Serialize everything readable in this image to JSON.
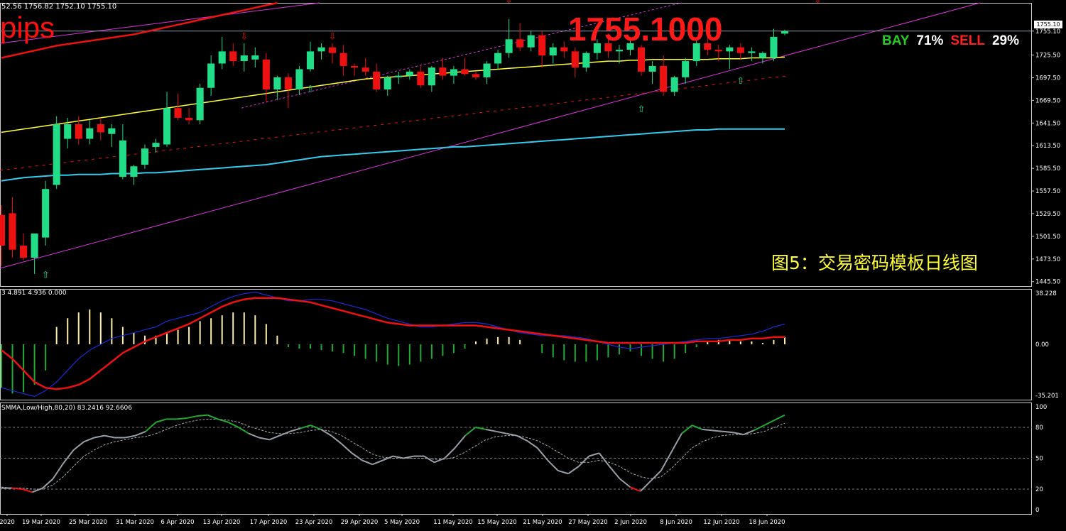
{
  "header": {
    "ohlc": "52.56 1756.82 1752.10 1755.10",
    "pips_label": "pips",
    "big_price": "1755.1000",
    "bay_label": "BAY",
    "bay_value": "71%",
    "sell_label": "SELL",
    "sell_value": "29%",
    "caption": "图5：交易密码模板日线图",
    "current_price_tag": "1755.10"
  },
  "panels": {
    "macd_header": "3 4.891 4.936 0.000",
    "stoch_header": "SMMA,Low/High,80,20) 83.2416 92.6606"
  },
  "colors": {
    "bull": "#22dd88",
    "bear": "#ee1111",
    "ma_yellow": "#ffff33",
    "ma_cyan": "#33ccee",
    "ma_red": "#ee1111",
    "channel": "#dd33dd",
    "macd_pos": "#ffeeaa",
    "macd_neg": "#22aa33",
    "macd_line": "#1a2bdd",
    "signal_line": "#ee1111",
    "stoch_main": "#9aa0aa",
    "stoch_up": "#22aa33",
    "stoch_down": "#ee1111"
  },
  "chart_data": [
    {
      "type": "candlestick",
      "title": "",
      "ylim": [
        1440,
        1790
      ],
      "y_ticks": [
        "1755.10",
        "1725.50",
        "1697.50",
        "1669.50",
        "1641.50",
        "1613.50",
        "1585.50",
        "1557.50",
        "1529.50",
        "1501.50",
        "1473.50",
        "1445.50"
      ],
      "x_ticks": [
        "2020",
        "19 Mar 2020",
        "25 Mar 2020",
        "31 Mar 2020",
        "6 Apr 2020",
        "13 Apr 2020",
        "17 Apr 2020",
        "23 Apr 2020",
        "29 Apr 2020",
        "5 May 2020",
        "11 May 2020",
        "15 May 2020",
        "21 May 2020",
        "27 May 2020",
        "2 Jun 2020",
        "8 Jun 2020",
        "12 Jun 2020",
        "18 Jun 2020"
      ],
      "candles": [
        {
          "o": 1528,
          "h": 1540,
          "l": 1465,
          "c": 1490
        },
        {
          "o": 1530,
          "h": 1550,
          "l": 1475,
          "c": 1485
        },
        {
          "o": 1490,
          "h": 1505,
          "l": 1472,
          "c": 1475
        },
        {
          "o": 1475,
          "h": 1505,
          "l": 1455,
          "c": 1505
        },
        {
          "o": 1500,
          "h": 1570,
          "l": 1490,
          "c": 1560
        },
        {
          "o": 1565,
          "h": 1650,
          "l": 1560,
          "c": 1640
        },
        {
          "o": 1622,
          "h": 1648,
          "l": 1610,
          "c": 1640
        },
        {
          "o": 1640,
          "h": 1650,
          "l": 1615,
          "c": 1622
        },
        {
          "o": 1622,
          "h": 1645,
          "l": 1615,
          "c": 1635
        },
        {
          "o": 1640,
          "h": 1648,
          "l": 1620,
          "c": 1630
        },
        {
          "o": 1628,
          "h": 1640,
          "l": 1612,
          "c": 1635
        },
        {
          "o": 1575,
          "h": 1640,
          "l": 1572,
          "c": 1620
        },
        {
          "o": 1575,
          "h": 1590,
          "l": 1565,
          "c": 1588
        },
        {
          "o": 1590,
          "h": 1615,
          "l": 1585,
          "c": 1610
        },
        {
          "o": 1612,
          "h": 1622,
          "l": 1605,
          "c": 1617
        },
        {
          "o": 1615,
          "h": 1680,
          "l": 1612,
          "c": 1660
        },
        {
          "o": 1660,
          "h": 1678,
          "l": 1645,
          "c": 1648
        },
        {
          "o": 1648,
          "h": 1660,
          "l": 1640,
          "c": 1645
        },
        {
          "o": 1645,
          "h": 1690,
          "l": 1640,
          "c": 1685
        },
        {
          "o": 1685,
          "h": 1725,
          "l": 1675,
          "c": 1715
        },
        {
          "o": 1715,
          "h": 1748,
          "l": 1708,
          "c": 1730
        },
        {
          "o": 1730,
          "h": 1740,
          "l": 1712,
          "c": 1718
        },
        {
          "o": 1718,
          "h": 1740,
          "l": 1705,
          "c": 1725
        },
        {
          "o": 1720,
          "h": 1735,
          "l": 1710,
          "c": 1725
        },
        {
          "o": 1720,
          "h": 1728,
          "l": 1668,
          "c": 1683
        },
        {
          "o": 1683,
          "h": 1700,
          "l": 1670,
          "c": 1698
        },
        {
          "o": 1698,
          "h": 1703,
          "l": 1660,
          "c": 1683
        },
        {
          "o": 1683,
          "h": 1712,
          "l": 1676,
          "c": 1708
        },
        {
          "o": 1708,
          "h": 1742,
          "l": 1705,
          "c": 1730
        },
        {
          "o": 1730,
          "h": 1740,
          "l": 1720,
          "c": 1735
        },
        {
          "o": 1735,
          "h": 1740,
          "l": 1715,
          "c": 1728
        },
        {
          "o": 1728,
          "h": 1738,
          "l": 1700,
          "c": 1712
        },
        {
          "o": 1712,
          "h": 1715,
          "l": 1700,
          "c": 1710
        },
        {
          "o": 1710,
          "h": 1722,
          "l": 1700,
          "c": 1705
        },
        {
          "o": 1705,
          "h": 1715,
          "l": 1680,
          "c": 1683
        },
        {
          "o": 1683,
          "h": 1700,
          "l": 1675,
          "c": 1698
        },
        {
          "o": 1698,
          "h": 1705,
          "l": 1690,
          "c": 1700
        },
        {
          "o": 1700,
          "h": 1708,
          "l": 1695,
          "c": 1705
        },
        {
          "o": 1705,
          "h": 1712,
          "l": 1685,
          "c": 1688
        },
        {
          "o": 1688,
          "h": 1712,
          "l": 1680,
          "c": 1710
        },
        {
          "o": 1710,
          "h": 1722,
          "l": 1695,
          "c": 1700
        },
        {
          "o": 1700,
          "h": 1712,
          "l": 1690,
          "c": 1708
        },
        {
          "o": 1708,
          "h": 1722,
          "l": 1700,
          "c": 1702
        },
        {
          "o": 1702,
          "h": 1705,
          "l": 1695,
          "c": 1698
        },
        {
          "o": 1698,
          "h": 1718,
          "l": 1690,
          "c": 1715
        },
        {
          "o": 1715,
          "h": 1732,
          "l": 1708,
          "c": 1728
        },
        {
          "o": 1728,
          "h": 1770,
          "l": 1722,
          "c": 1745
        },
        {
          "o": 1745,
          "h": 1765,
          "l": 1730,
          "c": 1735
        },
        {
          "o": 1735,
          "h": 1755,
          "l": 1730,
          "c": 1750
        },
        {
          "o": 1750,
          "h": 1755,
          "l": 1710,
          "c": 1725
        },
        {
          "o": 1725,
          "h": 1740,
          "l": 1715,
          "c": 1735
        },
        {
          "o": 1735,
          "h": 1742,
          "l": 1722,
          "c": 1730
        },
        {
          "o": 1730,
          "h": 1735,
          "l": 1698,
          "c": 1710
        },
        {
          "o": 1710,
          "h": 1730,
          "l": 1705,
          "c": 1728
        },
        {
          "o": 1728,
          "h": 1745,
          "l": 1720,
          "c": 1740
        },
        {
          "o": 1740,
          "h": 1752,
          "l": 1722,
          "c": 1730
        },
        {
          "o": 1730,
          "h": 1738,
          "l": 1715,
          "c": 1732
        },
        {
          "o": 1732,
          "h": 1745,
          "l": 1725,
          "c": 1740
        },
        {
          "o": 1735,
          "h": 1738,
          "l": 1700,
          "c": 1705
        },
        {
          "o": 1705,
          "h": 1718,
          "l": 1690,
          "c": 1712
        },
        {
          "o": 1712,
          "h": 1725,
          "l": 1675,
          "c": 1680
        },
        {
          "o": 1680,
          "h": 1700,
          "l": 1675,
          "c": 1698
        },
        {
          "o": 1698,
          "h": 1722,
          "l": 1690,
          "c": 1718
        },
        {
          "o": 1718,
          "h": 1745,
          "l": 1712,
          "c": 1740
        },
        {
          "o": 1740,
          "h": 1750,
          "l": 1725,
          "c": 1732
        },
        {
          "o": 1732,
          "h": 1738,
          "l": 1718,
          "c": 1730
        },
        {
          "o": 1730,
          "h": 1738,
          "l": 1708,
          "c": 1735
        },
        {
          "o": 1735,
          "h": 1740,
          "l": 1720,
          "c": 1728
        },
        {
          "o": 1728,
          "h": 1735,
          "l": 1718,
          "c": 1730
        },
        {
          "o": 1722,
          "h": 1730,
          "l": 1715,
          "c": 1728
        },
        {
          "o": 1722,
          "h": 1758,
          "l": 1718,
          "c": 1748
        },
        {
          "o": 1752,
          "h": 1757,
          "l": 1750,
          "c": 1755
        }
      ],
      "ma_yellow": [
        1630,
        1632,
        1634,
        1636,
        1638,
        1640,
        1642,
        1644,
        1646,
        1648,
        1650,
        1652,
        1654,
        1656,
        1658,
        1660,
        1662,
        1664,
        1666,
        1668,
        1670,
        1672,
        1674,
        1676,
        1678,
        1680,
        1682,
        1684,
        1686,
        1688,
        1690,
        1692,
        1694,
        1696,
        1697,
        1698,
        1699,
        1700,
        1701,
        1702,
        1703,
        1704,
        1705,
        1706,
        1707,
        1708,
        1709,
        1710,
        1711,
        1712,
        1713,
        1714,
        1715,
        1716,
        1717,
        1718,
        1718,
        1719,
        1719,
        1720,
        1720,
        1720,
        1720,
        1720,
        1720,
        1721,
        1721,
        1721,
        1722,
        1722,
        1722,
        1723
      ],
      "ma_cyan": [
        1570,
        1572,
        1574,
        1575,
        1576,
        1577,
        1577,
        1578,
        1578,
        1578,
        1579,
        1579,
        1579,
        1580,
        1580,
        1581,
        1582,
        1583,
        1584,
        1585,
        1586,
        1587,
        1588,
        1589,
        1590,
        1592,
        1594,
        1596,
        1598,
        1600,
        1601,
        1602,
        1603,
        1604,
        1605,
        1606,
        1607,
        1608,
        1609,
        1610,
        1611,
        1612,
        1612,
        1613,
        1614,
        1615,
        1616,
        1617,
        1618,
        1619,
        1620,
        1621,
        1622,
        1623,
        1624,
        1625,
        1626,
        1627,
        1628,
        1629,
        1630,
        1631,
        1632,
        1633,
        1633,
        1634,
        1634,
        1634,
        1634,
        1634,
        1634,
        1634
      ],
      "ma_red": [
        1722,
        1725,
        1728,
        1731,
        1734,
        1737,
        1739,
        1741,
        1743,
        1745,
        1747,
        1749,
        1751,
        1754,
        1757,
        1760,
        1763,
        1766,
        1769,
        1772,
        1775,
        1778,
        1781,
        1784,
        1787,
        1790
      ],
      "signals_down": [
        [
          22,
          1745
        ],
        [
          30,
          1745
        ],
        [
          46,
          1790
        ],
        [
          74,
          1790
        ]
      ],
      "signals_up": [
        [
          4,
          1450
        ],
        [
          28,
          1680
        ],
        [
          58,
          1655
        ],
        [
          67,
          1690
        ]
      ]
    },
    {
      "type": "bar",
      "name": "macd",
      "ylim": [
        -38.228,
        38.228
      ],
      "y_ticks": [
        "38.228",
        "0.00",
        "-35.201"
      ],
      "histogram": [
        -30,
        -34,
        -33,
        -28,
        -18,
        12,
        18,
        22,
        24,
        22,
        18,
        12,
        8,
        6,
        6,
        8,
        10,
        12,
        16,
        18,
        20,
        22,
        22,
        20,
        14,
        6,
        -2,
        -3,
        -3,
        -4,
        -5,
        -6,
        -8,
        -10,
        -12,
        -14,
        -15,
        -14,
        -12,
        -10,
        -8,
        -6,
        -3,
        2,
        4,
        5,
        5,
        3,
        0,
        -6,
        -9,
        -11,
        -12,
        -12,
        -11,
        -9,
        -7,
        -5,
        -8,
        -10,
        -12,
        -10,
        -6,
        -2,
        2,
        3,
        3,
        2,
        2,
        1,
        3,
        5
      ],
      "macd_line": [
        -30,
        -32,
        -34,
        -36,
        -32,
        -26,
        -18,
        -10,
        -4,
        0,
        4,
        6,
        8,
        10,
        12,
        16,
        18,
        20,
        22,
        26,
        30,
        33,
        35,
        36,
        34,
        32,
        30,
        30,
        31,
        31,
        30,
        28,
        26,
        24,
        21,
        18,
        16,
        14,
        12,
        12,
        13,
        14,
        15,
        15,
        14,
        12,
        10,
        8,
        7,
        6,
        6,
        6,
        5,
        4,
        2,
        0,
        -2,
        -3,
        -2,
        -1,
        0,
        1,
        2,
        3,
        4,
        4,
        5,
        6,
        7,
        9,
        12,
        14
      ],
      "signal_line": [
        -4,
        -10,
        -18,
        -26,
        -30,
        -31,
        -30,
        -28,
        -24,
        -18,
        -12,
        -6,
        -2,
        2,
        5,
        8,
        11,
        14,
        18,
        22,
        26,
        29,
        31,
        32,
        32,
        32,
        31,
        30,
        29,
        27,
        25,
        23,
        21,
        19,
        17,
        15,
        14,
        13,
        13,
        13,
        13,
        13,
        13,
        13,
        12,
        11,
        10,
        9,
        8,
        7,
        6,
        5,
        4,
        3,
        2,
        1,
        1,
        1,
        1,
        1,
        1,
        1,
        1,
        2,
        2,
        2,
        3,
        3,
        4,
        4,
        5,
        5
      ]
    },
    {
      "type": "line",
      "name": "stochastic",
      "ylim": [
        0,
        100
      ],
      "y_ticks": [
        "100",
        "80",
        "50",
        "20",
        "0"
      ],
      "levels": [
        80,
        50,
        20
      ],
      "main": [
        21,
        21,
        20,
        17,
        21,
        30,
        45,
        58,
        66,
        70,
        72,
        70,
        70,
        72,
        76,
        85,
        88,
        88,
        89,
        91,
        92,
        88,
        85,
        80,
        74,
        70,
        68,
        72,
        76,
        79,
        82,
        78,
        72,
        64,
        55,
        48,
        44,
        48,
        52,
        50,
        52,
        52,
        46,
        50,
        60,
        72,
        80,
        78,
        76,
        74,
        72,
        67,
        60,
        48,
        38,
        35,
        42,
        52,
        55,
        42,
        30,
        22,
        18,
        28,
        38,
        56,
        74,
        82,
        78,
        77,
        76,
        75,
        73,
        77,
        82,
        87,
        92
      ],
      "signal": [
        22,
        21,
        21,
        20,
        20,
        24,
        32,
        42,
        52,
        58,
        63,
        66,
        68,
        70,
        71,
        74,
        78,
        82,
        85,
        87,
        88,
        88,
        87,
        85,
        81,
        78,
        75,
        74,
        74,
        75,
        77,
        78,
        76,
        72,
        66,
        60,
        54,
        51,
        50,
        50,
        50,
        50,
        49,
        49,
        51,
        56,
        62,
        68,
        71,
        72,
        72,
        70,
        67,
        62,
        56,
        50,
        46,
        46,
        48,
        46,
        42,
        36,
        32,
        30,
        32,
        40,
        50,
        60,
        66,
        70,
        72,
        73,
        73,
        74,
        76,
        80,
        84
      ]
    }
  ]
}
